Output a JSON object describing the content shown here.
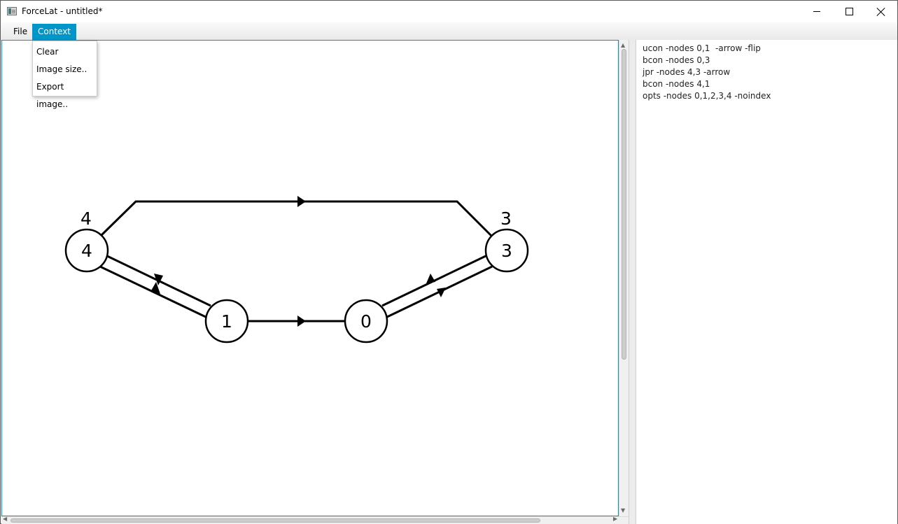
{
  "window": {
    "title": "ForceLat - untitled*"
  },
  "menubar": {
    "items": [
      {
        "label": "File"
      },
      {
        "label": "Context"
      }
    ]
  },
  "context_menu": {
    "items": [
      {
        "label": "Clear"
      },
      {
        "label": "Image size.."
      },
      {
        "label": "Export image.."
      }
    ]
  },
  "script": {
    "lines": [
      "ucon -nodes 0,1  -arrow -flip",
      "bcon -nodes 0,3",
      "jpr -nodes 4,3 -arrow",
      "bcon -nodes 4,1",
      "opts -nodes 0,1,2,3,4 -noindex"
    ]
  },
  "graph": {
    "nodes": [
      {
        "label": "4",
        "outer_label": "4"
      },
      {
        "label": "1"
      },
      {
        "label": "0"
      },
      {
        "label": "3",
        "outer_label": "3"
      }
    ]
  },
  "icons": {
    "app": "app-icon",
    "minimize": "minimize-icon",
    "maximize": "maximize-icon",
    "close": "close-icon"
  }
}
